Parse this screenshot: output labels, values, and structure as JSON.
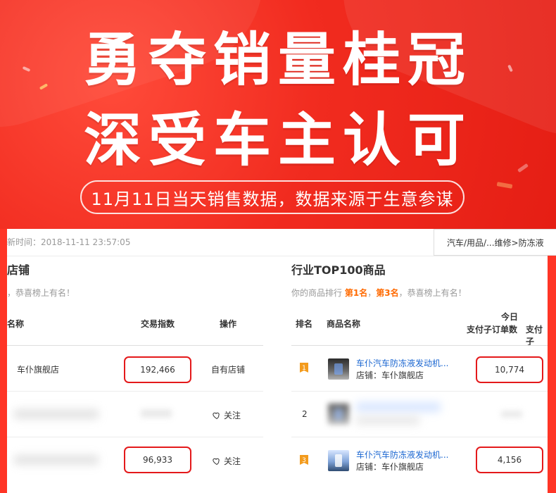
{
  "banner": {
    "headline_line1": "勇夺销量桂冠",
    "headline_line2": "深受车主认可",
    "subtitle": "11月11日当天销售数据，数据来源于生意参谋"
  },
  "panel": {
    "update_time": "新时间：2018-11-11 23:57:05",
    "category_breadcrumb": "汽车/用品/...维修>防冻液",
    "left": {
      "title": "店铺",
      "note": "，恭喜榜上有名！",
      "headers": {
        "name": "名称",
        "index": "交易指数",
        "action": "操作"
      },
      "rows": [
        {
          "name": "车仆旗舰店",
          "index": "192,466",
          "action": "自有店铺",
          "highlighted": true,
          "blurred": false
        },
        {
          "name": "",
          "index": "",
          "action": "关注",
          "highlighted": false,
          "blurred": true
        },
        {
          "name": "",
          "index": "96,933",
          "action": "关注",
          "highlighted": true,
          "blurred": true
        }
      ]
    },
    "right": {
      "title": "行业TOP100商品",
      "note_prefix": "你的商品排行",
      "note_rank1": "第1名",
      "note_sep": "，",
      "note_rank3": "第3名",
      "note_suffix": "，恭喜榜上有名！",
      "headers": {
        "rank": "排名",
        "product": "商品名称",
        "today": "今日",
        "sub_orders": "支付子订单数",
        "sub_cut": "支付子"
      },
      "rows": [
        {
          "rank": "1",
          "title": "车仆汽车防冻液发动机...",
          "shop": "店铺：车仆旗舰店",
          "orders": "10,774",
          "highlighted": true,
          "blurred": false
        },
        {
          "rank": "2",
          "title": "",
          "shop": "",
          "orders": "",
          "highlighted": false,
          "blurred": true
        },
        {
          "rank": "3",
          "title": "车仆汽车防冻液发动机...",
          "shop": "店铺：车仆旗舰店",
          "orders": "4,156",
          "highlighted": true,
          "blurred": false
        }
      ]
    }
  },
  "colors": {
    "banner_red": "#f12b1f",
    "accent_red": "#e4191b",
    "rank_badge": "#f39b1d",
    "link_blue": "#1a66d1"
  }
}
